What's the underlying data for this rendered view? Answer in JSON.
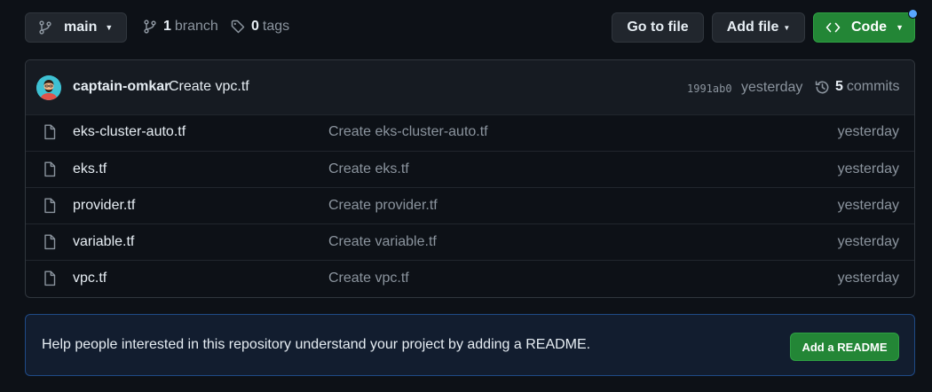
{
  "toolbar": {
    "branch_selector": {
      "label": "main"
    },
    "branches": {
      "count": "1",
      "label": "branch"
    },
    "tags": {
      "count": "0",
      "label": "tags"
    },
    "go_to_file_label": "Go to file",
    "add_file_label": "Add file",
    "code_label": "Code"
  },
  "latest_commit": {
    "author": "captain-omkar",
    "message": "Create vpc.tf",
    "sha": "1991ab0",
    "time": "yesterday",
    "commits_count": "5",
    "commits_label": "commits"
  },
  "files": [
    {
      "name": "eks-cluster-auto.tf",
      "commit_message": "Create eks-cluster-auto.tf",
      "time": "yesterday"
    },
    {
      "name": "eks.tf",
      "commit_message": "Create eks.tf",
      "time": "yesterday"
    },
    {
      "name": "provider.tf",
      "commit_message": "Create provider.tf",
      "time": "yesterday"
    },
    {
      "name": "variable.tf",
      "commit_message": "Create variable.tf",
      "time": "yesterday"
    },
    {
      "name": "vpc.tf",
      "commit_message": "Create vpc.tf",
      "time": "yesterday"
    }
  ],
  "readme_banner": {
    "text": "Help people interested in this repository understand your project by adding a README.",
    "button_label": "Add a README"
  },
  "icons": {
    "branch": "git-branch-icon",
    "tag": "tag-icon",
    "code": "code-icon",
    "history": "history-icon",
    "file": "file-icon"
  },
  "colors": {
    "background": "#0d1117",
    "green_button": "#238636",
    "notification_dot": "#58a6ff",
    "banner_border": "#1f4a86"
  }
}
